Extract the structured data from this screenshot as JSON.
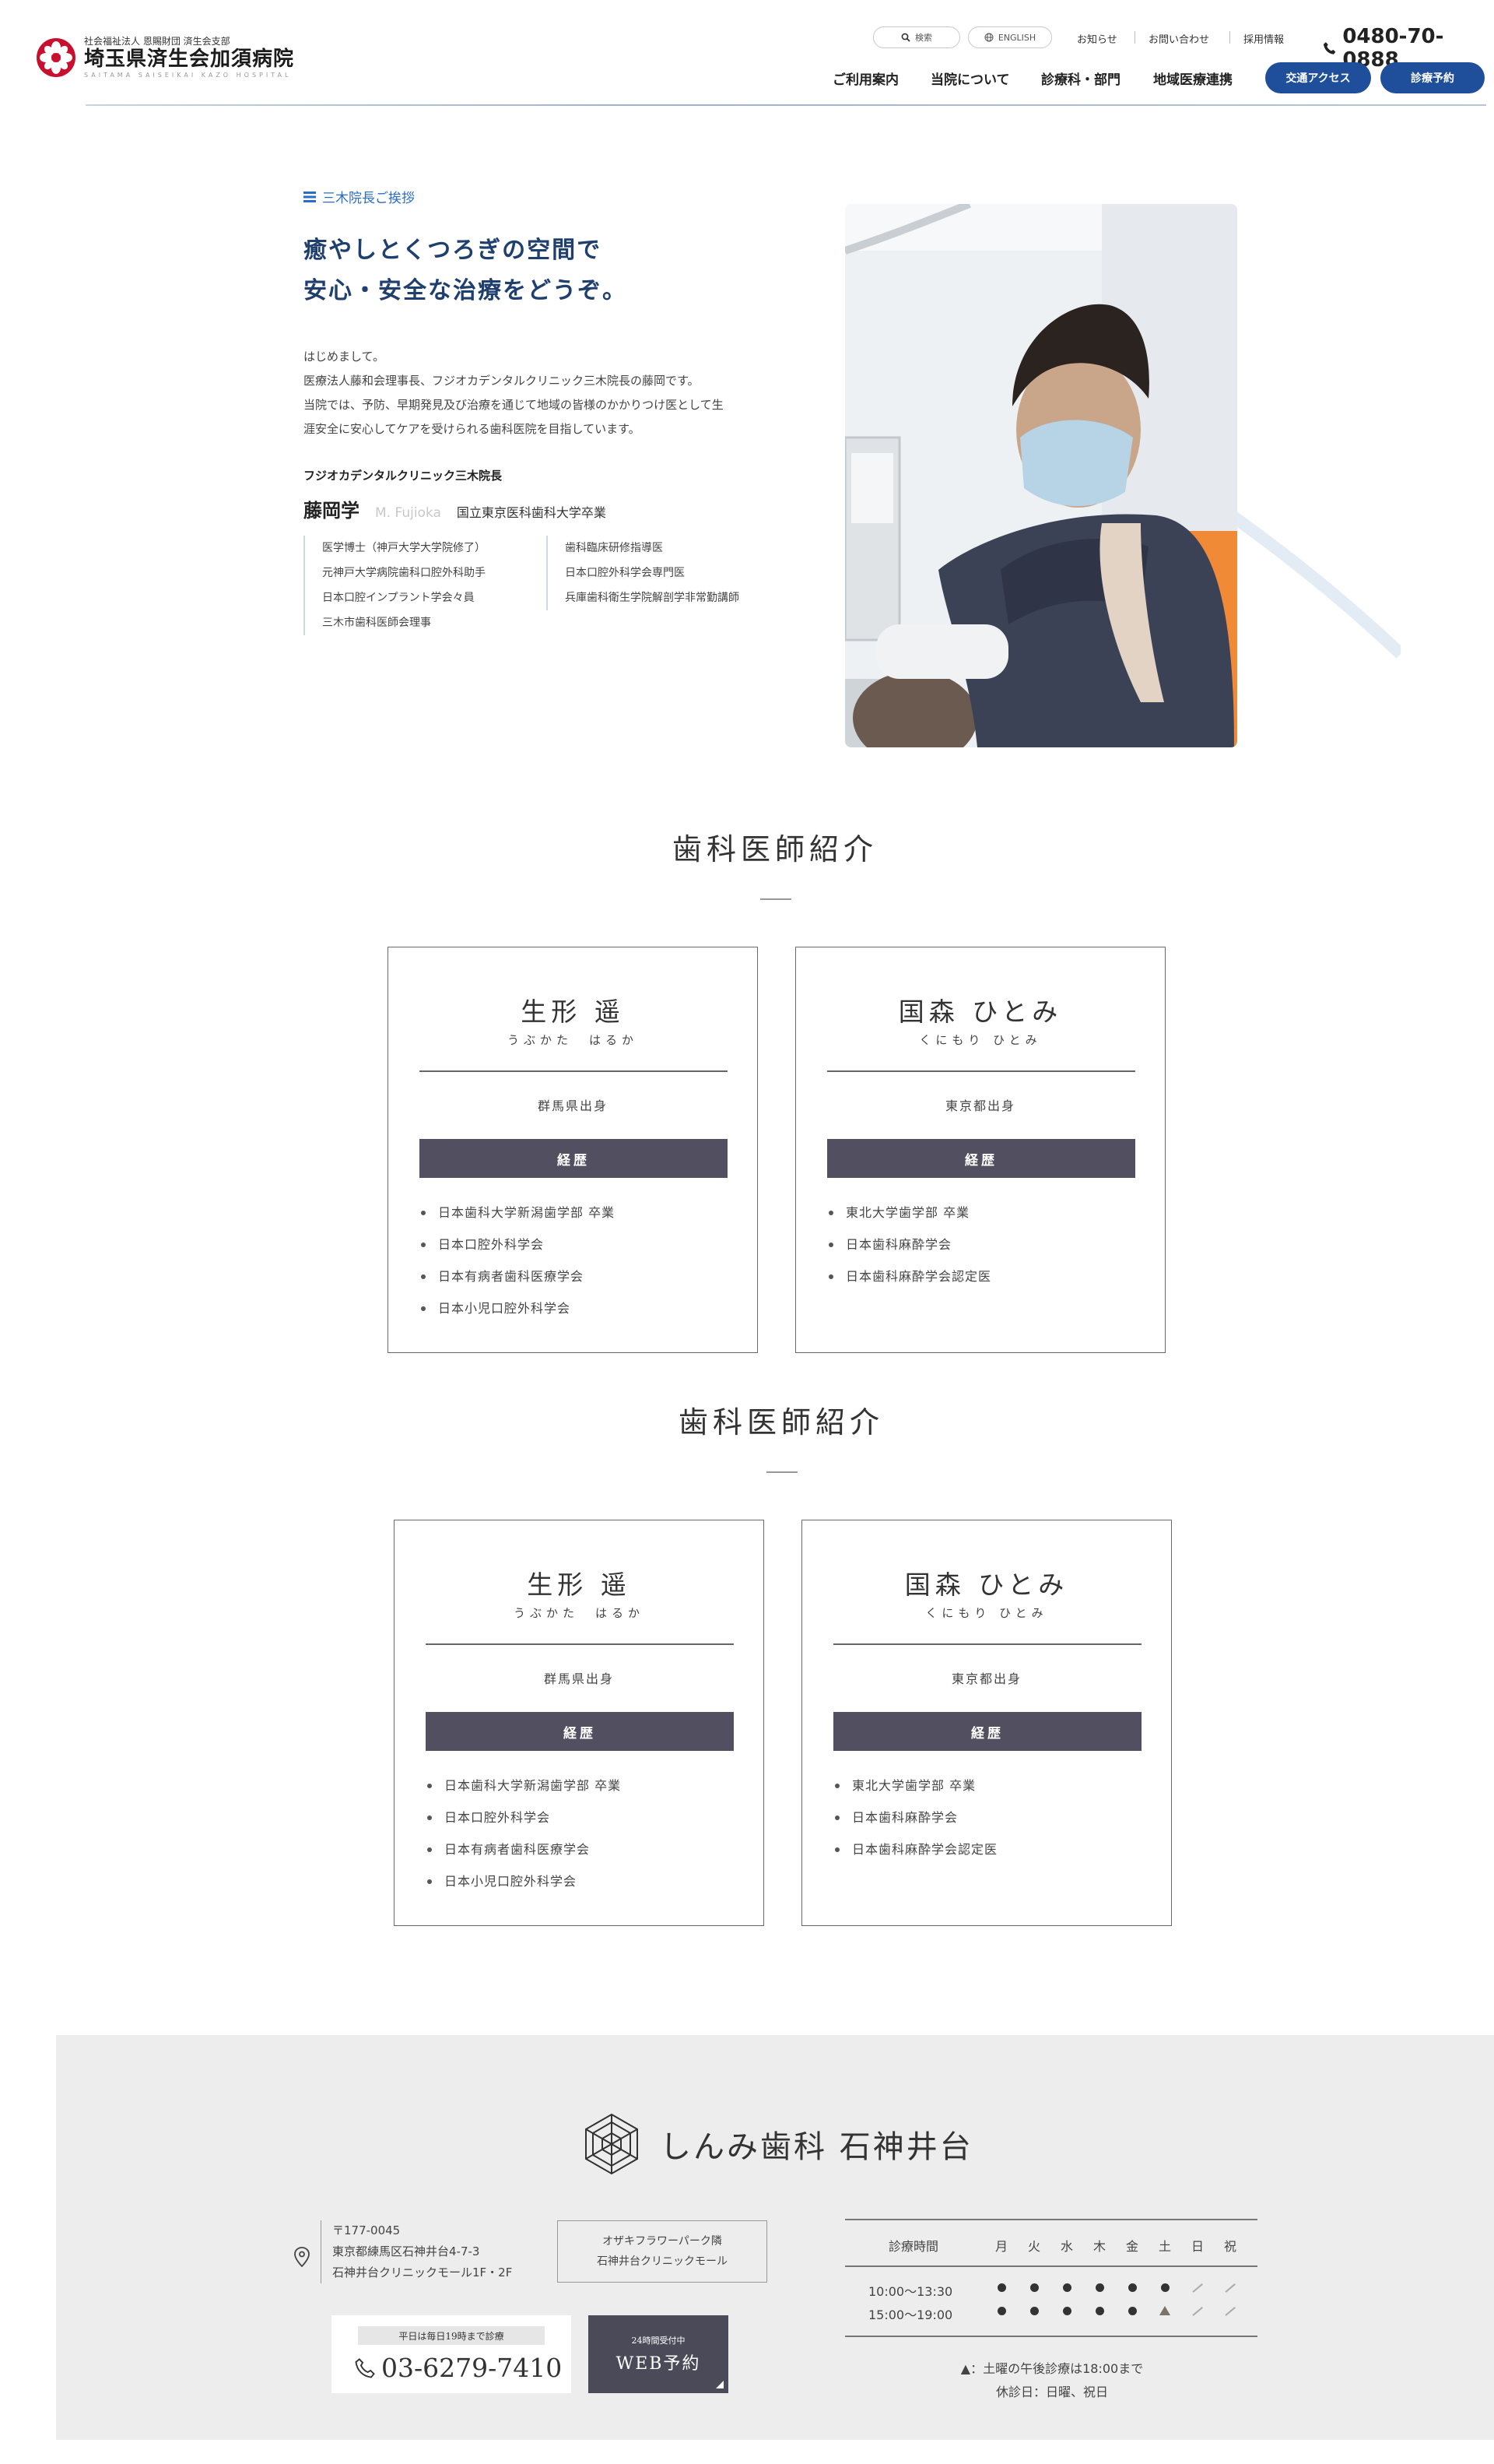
{
  "header": {
    "logo_sub": "社会福祉法人 恩賜財団 済生会支部",
    "logo_main": "埼玉県済生会加須病院",
    "logo_en": "SAITAMA SAISEIKAI KAZO HOSPITAL",
    "search_label": "検索",
    "english_label": "ENGLISH",
    "top_links": [
      "お知らせ",
      "お問い合わせ",
      "採用情報"
    ],
    "phone": "0480-70-0888",
    "nav": [
      "ご利用案内",
      "当院について",
      "診療科・部門",
      "地域医療連携"
    ],
    "access_button": "交通アクセス",
    "reserve_button": "診療予約",
    "accent_color": "#1f4f9a"
  },
  "greeting": {
    "label": "三木院長ご挨拶",
    "heading_line1": "癒やしとくつろぎの空間で",
    "heading_line2": "安心・安全な治療をどうぞ。",
    "body": [
      "はじめまして。",
      "医療法人藤和会理事長、フジオカデンタルクリニック三木院長の藤岡です。",
      "当院では、予防、早期発見及び治療を通じて地域の皆様のかかりつけ医として生",
      "涯安全に安心してケアを受けられる歯科医院を目指しています。"
    ],
    "director_title": "フジオカデンタルクリニック三木院長",
    "director_name": "藤岡学",
    "director_roman": "M. Fujioka",
    "director_school": "国立東京医科歯科大学卒業",
    "credentials_left": [
      "医学博士（神戸大学大学院修了）",
      "元神戸大学病院歯科口腔外科助手",
      "日本口腔インプラント学会々員",
      "三木市歯科医師会理事"
    ],
    "credentials_right": [
      "歯科臨床研修指導医",
      "日本口腔外科学会専門医",
      "兵庫歯科衛生学院解剖学非常勤講師"
    ]
  },
  "sections": [
    {
      "title": "歯科医師紹介",
      "doctors": [
        {
          "name": "生形 遥",
          "kana": "うぶかた　はるか",
          "origin": "群馬県出身",
          "career_label": "経歴",
          "career": [
            "日本歯科大学新潟歯学部 卒業",
            "日本口腔外科学会",
            "日本有病者歯科医療学会",
            "日本小児口腔外科学会"
          ]
        },
        {
          "name": "国森 ひとみ",
          "kana": "くにもり ひとみ",
          "origin": "東京都出身",
          "career_label": "経歴",
          "career": [
            "東北大学歯学部 卒業",
            "日本歯科麻酔学会",
            "日本歯科麻酔学会認定医"
          ]
        }
      ]
    },
    {
      "title": "歯科医師紹介",
      "doctors": [
        {
          "name": "生形 遥",
          "kana": "うぶかた　はるか",
          "origin": "群馬県出身",
          "career_label": "経歴",
          "career": [
            "日本歯科大学新潟歯学部 卒業",
            "日本口腔外科学会",
            "日本有病者歯科医療学会",
            "日本小児口腔外科学会"
          ]
        },
        {
          "name": "国森 ひとみ",
          "kana": "くにもり ひとみ",
          "origin": "東京都出身",
          "career_label": "経歴",
          "career": [
            "東北大学歯学部 卒業",
            "日本歯科麻酔学会",
            "日本歯科麻酔学会認定医"
          ]
        }
      ]
    }
  ],
  "footer": {
    "clinic_name": "しんみ歯科 石神井台",
    "address": [
      "〒177-0045",
      "東京都練馬区石神井台4-7-3",
      "石神井台クリニックモール1F・2F"
    ],
    "landmark": [
      "オザキフラワーパーク隣",
      "石神井台クリニックモール"
    ],
    "tel_note": "平日は毎日19時まで診療",
    "tel": "03-6279-7410",
    "web_small": "24時間受付中",
    "web_main": "WEB予約",
    "hours": {
      "header_label": "診療時間",
      "days": [
        "月",
        "火",
        "水",
        "木",
        "金",
        "土",
        "日",
        "祝"
      ],
      "rows": [
        {
          "time": "10:00〜13:30",
          "marks": [
            "dot",
            "dot",
            "dot",
            "dot",
            "dot",
            "dot",
            "slash",
            "slash"
          ]
        },
        {
          "time": "15:00〜19:00",
          "marks": [
            "dot",
            "dot",
            "dot",
            "dot",
            "dot",
            "tri",
            "slash",
            "slash"
          ]
        }
      ],
      "note_line1": "▲：土曜の午後診療は18:00まで",
      "note_line2": "休診日：日曜、祝日"
    }
  }
}
